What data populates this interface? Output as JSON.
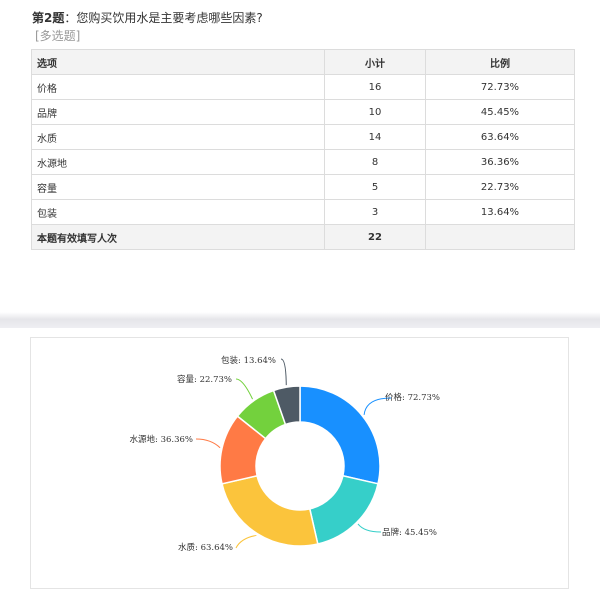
{
  "question": {
    "number_label": "第2题",
    "text": "：您购买饮用水是主要考虑哪些因素?",
    "type_label": "[多选题]"
  },
  "table": {
    "headers": [
      "选项",
      "小计",
      "比例"
    ],
    "rows": [
      {
        "option": "价格",
        "count": "16",
        "ratio": "72.73%"
      },
      {
        "option": "品牌",
        "count": "10",
        "ratio": "45.45%"
      },
      {
        "option": "水质",
        "count": "14",
        "ratio": "63.64%"
      },
      {
        "option": "水源地",
        "count": "8",
        "ratio": "36.36%"
      },
      {
        "option": "容量",
        "count": "5",
        "ratio": "22.73%"
      },
      {
        "option": "包装",
        "count": "3",
        "ratio": "13.64%"
      }
    ],
    "total_label": "本题有效填写人次",
    "total_value": "22"
  },
  "chart_data": {
    "type": "pie",
    "donut": true,
    "labels": [
      "价格",
      "品牌",
      "水质",
      "水源地",
      "容量",
      "包装"
    ],
    "values": [
      16,
      10,
      14,
      8,
      5,
      3
    ],
    "percent_labels": [
      "72.73%",
      "45.45%",
      "63.64%",
      "36.36%",
      "22.73%",
      "13.64%"
    ],
    "colors": [
      "#1890ff",
      "#36cfc9",
      "#fbc43c",
      "#ff7a45",
      "#73d13d",
      "#4e5a65"
    ]
  }
}
